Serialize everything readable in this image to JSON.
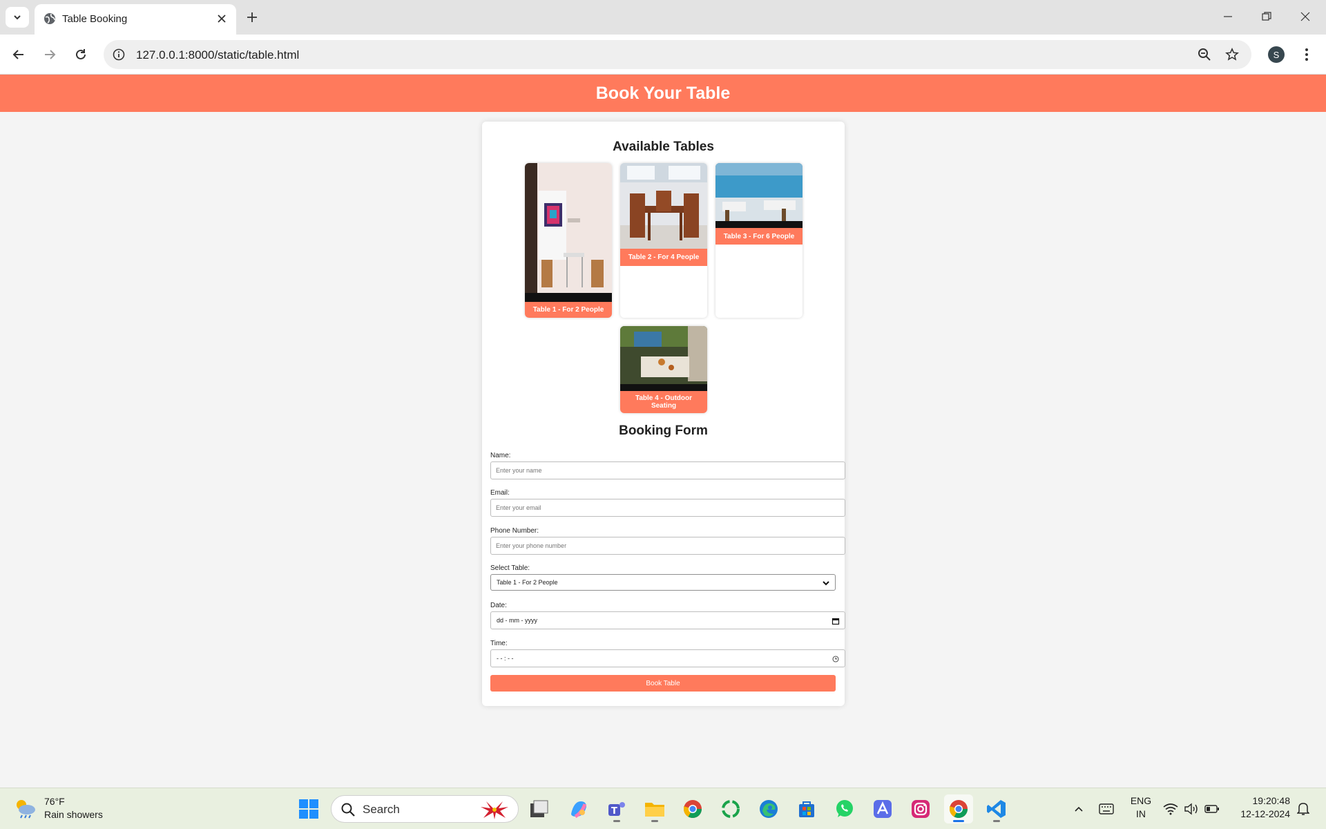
{
  "browser": {
    "tab_title": "Table Booking",
    "url": "127.0.0.1:8000/static/table.html",
    "profile_initial": "S"
  },
  "page": {
    "header_title": "Book Your Table",
    "accent_color": "#ff7a5c",
    "tables_heading": "Available Tables",
    "tables": [
      {
        "label": "Table 1 - For 2 People"
      },
      {
        "label": "Table 2 - For 4 People"
      },
      {
        "label": "Table 3 - For 6 People"
      },
      {
        "label": "Table 4 - Outdoor Seating"
      }
    ],
    "form_heading": "Booking Form",
    "form": {
      "name_label": "Name:",
      "name_placeholder": "Enter your name",
      "email_label": "Email:",
      "email_placeholder": "Enter your email",
      "phone_label": "Phone Number:",
      "phone_placeholder": "Enter your phone number",
      "table_label": "Select Table:",
      "table_selected": "Table 1 - For 2 People",
      "date_label": "Date:",
      "date_value": "dd - mm - yyyy",
      "time_label": "Time:",
      "time_value": "- - : - -",
      "submit_label": "Book Table"
    }
  },
  "taskbar": {
    "weather_temp": "76°F",
    "weather_desc": "Rain showers",
    "search_label": "Search",
    "lang_top": "ENG",
    "lang_bottom": "IN",
    "time": "19:20:48",
    "date": "12-12-2024"
  }
}
